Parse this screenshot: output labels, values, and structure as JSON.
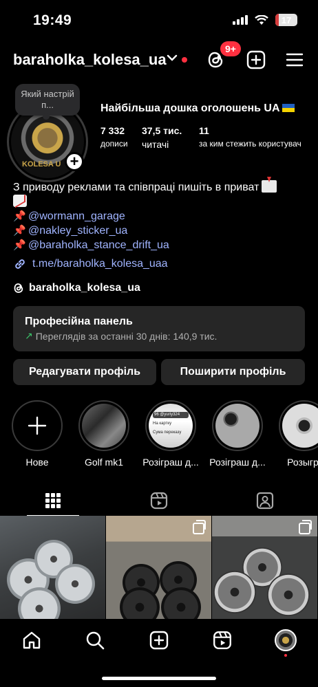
{
  "status_bar": {
    "time": "19:49",
    "battery": "17",
    "battery_level": 0.17
  },
  "header": {
    "username": "baraholka_kolesa_ua",
    "notification_badge": "9+"
  },
  "profile": {
    "note": "Який настрій п...",
    "avatar_text": "KOLESA U",
    "title": "Найбільша дошка оголошень UA",
    "stats": [
      {
        "value": "7 332",
        "label": "дописи"
      },
      {
        "value": "37,5 тис.",
        "label": "читачі"
      },
      {
        "value": "11",
        "label": "за ким стежить користувач"
      }
    ],
    "bio": {
      "line1": "З приводу реклами та співпраці пишіть в приват",
      "mentions": [
        "@wormann_garage",
        "@nakley_sticker_ua",
        "@baraholka_stance_drift_ua"
      ],
      "link": "t.me/baraholka_kolesa_uaa",
      "threads": "baraholka_kolesa_ua"
    }
  },
  "pro_panel": {
    "title": "Професійна панель",
    "subtitle": "Переглядів за останні 30 днів: 140,9 тис."
  },
  "buttons": {
    "edit": "Редагувати профіль",
    "share": "Поширити профіль"
  },
  "highlights": [
    {
      "label": "Нове"
    },
    {
      "label": "Golf mk1"
    },
    {
      "label": "Розіграш д..."
    },
    {
      "label": "Розіграш д..."
    },
    {
      "label": "Розыгры"
    }
  ],
  "highlight_preview": {
    "line1": "96 @yuriy324",
    "line2": "На картку",
    "line3": "Сума переказу"
  },
  "colors": {
    "background": "#000000",
    "panel": "#262626",
    "link": "#a0b4ff",
    "badge": "#ff3040"
  },
  "icons": {
    "header": [
      "threads-icon",
      "add-post-icon",
      "menu-icon"
    ],
    "tabs": [
      "grid-icon",
      "reels-icon",
      "tagged-icon"
    ],
    "nav": [
      "home-icon",
      "search-icon",
      "create-icon",
      "reels-icon",
      "profile-avatar"
    ]
  }
}
